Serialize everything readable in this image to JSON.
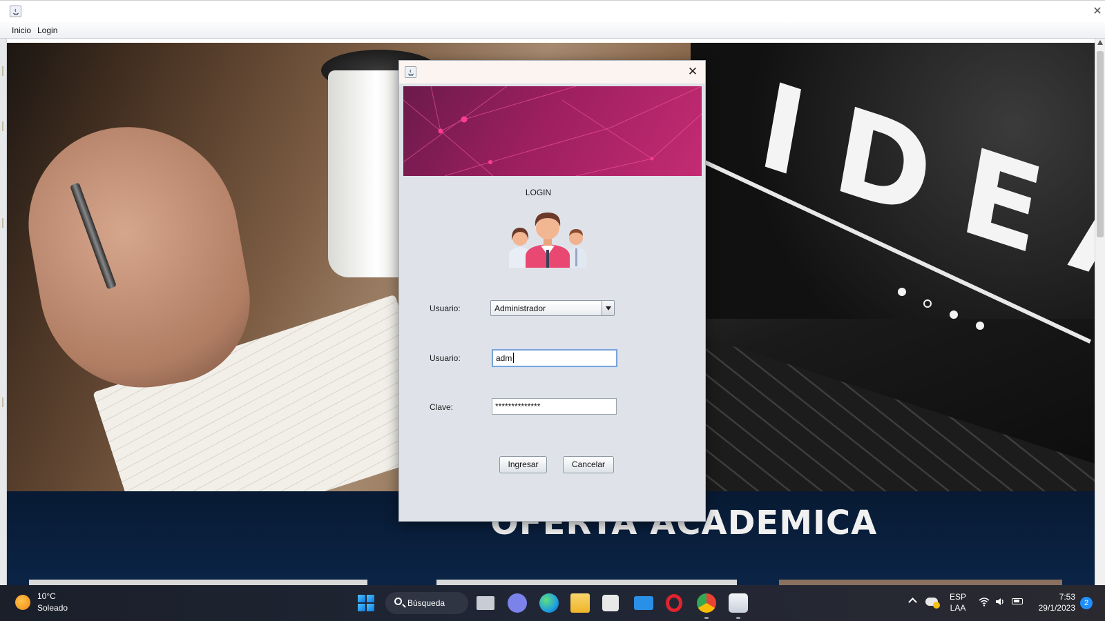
{
  "app": {
    "icon": "java-app-icon",
    "close_glyph": "✕"
  },
  "menubar": {
    "items": [
      {
        "label": "Inicio"
      },
      {
        "label": "Login"
      }
    ]
  },
  "background": {
    "banner_text": "IDEA",
    "section_title": "OFERTA ACADEMICA"
  },
  "dialog": {
    "icon": "java-app-icon",
    "close_glyph": "✕",
    "title": "LOGIN",
    "user_type_label": "Usuario:",
    "user_type_value": "Administrador",
    "username_label": "Usuario:",
    "username_value": "adm",
    "password_label": "Clave:",
    "password_value": "**************",
    "submit_label": "Ingresar",
    "cancel_label": "Cancelar",
    "banner_color": "#9c1f5f"
  },
  "taskbar": {
    "weather": {
      "temperature": "10°C",
      "condition": "Soleado",
      "icon": "sun-icon"
    },
    "search_label": "Búsqueda",
    "apps": [
      {
        "name": "task-view-icon",
        "color": "#c8ccd4"
      },
      {
        "name": "teams-chat-icon",
        "color": "#7b83eb"
      },
      {
        "name": "edge-icon",
        "color": "#1fa0e0"
      },
      {
        "name": "file-explorer-icon",
        "color": "#f5c242"
      },
      {
        "name": "store-icon",
        "color": "#e8e8e8"
      },
      {
        "name": "mail-icon",
        "color": "#2a8fe6"
      },
      {
        "name": "opera-icon",
        "color": "#e0242e"
      },
      {
        "name": "chrome-icon",
        "color": "#34a853"
      },
      {
        "name": "java-app-icon",
        "color": "#d8dde6"
      }
    ],
    "tray": {
      "language_line1": "ESP",
      "language_line2": "LAA",
      "time": "7:53",
      "date": "29/1/2023",
      "notification_count": "2"
    }
  }
}
